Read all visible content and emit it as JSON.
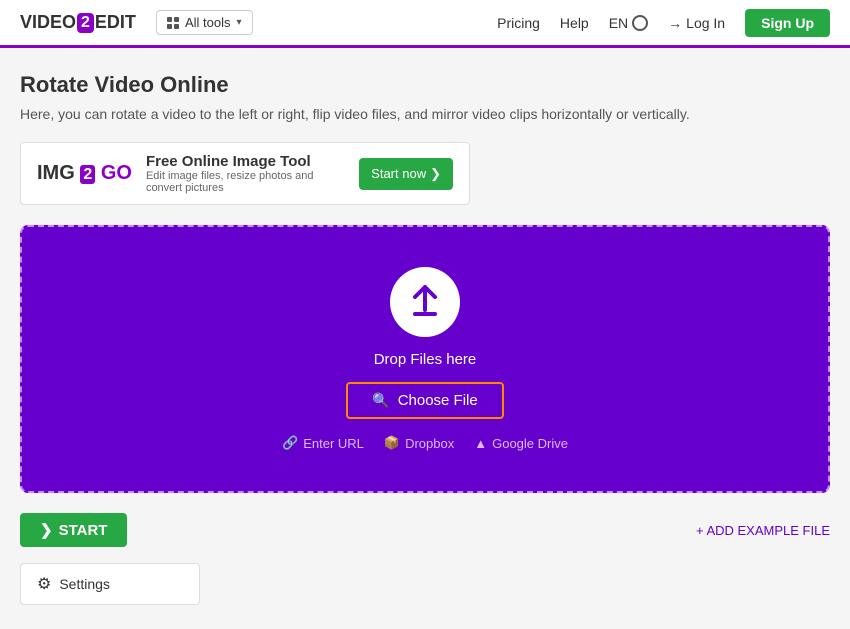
{
  "header": {
    "logo": {
      "part1": "VIDEO",
      "part2": "2",
      "part3": "EDIT"
    },
    "allTools": "All tools",
    "nav": {
      "pricing": "Pricing",
      "help": "Help",
      "lang": "EN",
      "login": "Log In",
      "signup": "Sign Up"
    }
  },
  "page": {
    "title": "Rotate Video Online",
    "description": "Here, you can rotate a video to the left or right, flip video files, and mirror video clips horizontally or vertically."
  },
  "ad": {
    "logo": "IMG 2 GO",
    "title": "Free Online Image Tool",
    "subtitle": "Edit image files, resize photos and convert pictures",
    "startBtn": "Start now"
  },
  "dropzone": {
    "dropText": "Drop Files here",
    "chooseFile": "Choose File",
    "links": {
      "url": "Enter URL",
      "dropbox": "Dropbox",
      "googleDrive": "Google Drive"
    }
  },
  "actions": {
    "start": "START",
    "addExample": "+ ADD EXAMPLE FILE",
    "settings": "Settings"
  }
}
